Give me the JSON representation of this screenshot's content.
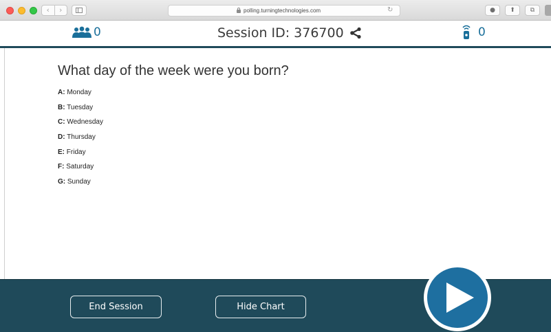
{
  "browser": {
    "url": "polling.turningtechnologies.com",
    "nav_back_glyph": "‹",
    "nav_forward_glyph": "›",
    "reload_glyph": "↻",
    "toolbar_glyphs": [
      "●",
      "⬆",
      "⧉"
    ]
  },
  "header": {
    "participants_count": "0",
    "session_label": "Session ID:",
    "session_id": "376700",
    "clickers_count": "0"
  },
  "question": {
    "text": "What day of the week were you born?",
    "answers": [
      {
        "key": "A:",
        "label": "Monday"
      },
      {
        "key": "B:",
        "label": "Tuesday"
      },
      {
        "key": "C:",
        "label": "Wednesday"
      },
      {
        "key": "D:",
        "label": "Thursday"
      },
      {
        "key": "E:",
        "label": "Friday"
      },
      {
        "key": "F:",
        "label": "Saturday"
      },
      {
        "key": "G:",
        "label": "Sunday"
      }
    ]
  },
  "footer": {
    "end_session_label": "End Session",
    "hide_chart_label": "Hide Chart"
  },
  "colors": {
    "footer_bg": "#1f4a5a",
    "accent_blue": "#1a6f9a",
    "play_button": "#1e6fa0"
  },
  "icons": {
    "participants": "users-icon",
    "share": "share-icon",
    "clicker": "clicker-remote-icon",
    "play": "play-icon"
  }
}
